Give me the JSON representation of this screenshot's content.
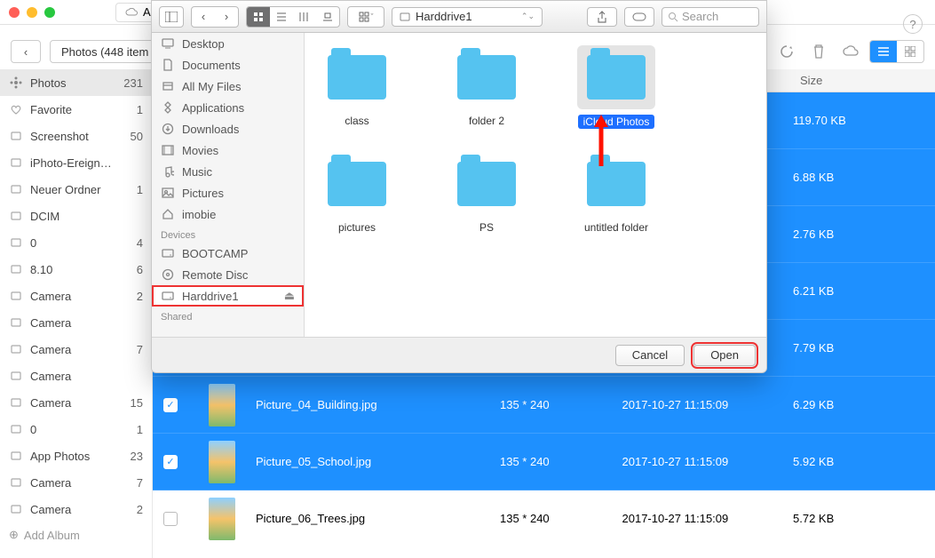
{
  "app": {
    "device_label": "Aaro",
    "help_tooltip": "?",
    "breadcrumb_back": "‹",
    "breadcrumb_label": "Photos (448 item",
    "toolbar": {
      "view_list": "≡",
      "view_grid": "⊞"
    },
    "columns": {
      "size": "Size"
    },
    "sidebar": [
      {
        "icon": "flower",
        "label": "Photos",
        "count": "231",
        "selected": true
      },
      {
        "icon": "heart",
        "label": "Favorite",
        "count": "1"
      },
      {
        "icon": "album",
        "label": "Screenshot",
        "count": "50"
      },
      {
        "icon": "album",
        "label": "iPhoto-Ereign…",
        "count": ""
      },
      {
        "icon": "album",
        "label": "Neuer Ordner",
        "count": "1"
      },
      {
        "icon": "album",
        "label": "DCIM",
        "count": ""
      },
      {
        "icon": "album",
        "label": "0",
        "count": "4"
      },
      {
        "icon": "album",
        "label": "8.10",
        "count": "6"
      },
      {
        "icon": "album",
        "label": "Camera",
        "count": "2"
      },
      {
        "icon": "album",
        "label": "Camera",
        "count": ""
      },
      {
        "icon": "album",
        "label": "Camera",
        "count": "7"
      },
      {
        "icon": "album",
        "label": "Camera",
        "count": ""
      },
      {
        "icon": "album",
        "label": "Camera",
        "count": "15"
      },
      {
        "icon": "album",
        "label": "0",
        "count": "1"
      },
      {
        "icon": "album",
        "label": "App Photos",
        "count": "23"
      },
      {
        "icon": "album",
        "label": "Camera",
        "count": "7"
      },
      {
        "icon": "album",
        "label": "Camera",
        "count": "2"
      }
    ],
    "add_album": "Add Album",
    "files": [
      {
        "checked": false,
        "name": "",
        "dim": "",
        "date": "",
        "size": "119.70 KB",
        "selected": true
      },
      {
        "checked": false,
        "name": "",
        "dim": "",
        "date": "",
        "size": "6.88 KB",
        "selected": true
      },
      {
        "checked": false,
        "name": "",
        "dim": "",
        "date": "",
        "size": "2.76 KB",
        "selected": true
      },
      {
        "checked": false,
        "name": "",
        "dim": "",
        "date": "",
        "size": "6.21 KB",
        "selected": true
      },
      {
        "checked": false,
        "name": "",
        "dim": "",
        "date": "",
        "size": "7.79 KB",
        "selected": true
      },
      {
        "checked": true,
        "name": "Picture_04_Building.jpg",
        "dim": "135 * 240",
        "date": "2017-10-27 11:15:09",
        "size": "6.29 KB",
        "selected": true
      },
      {
        "checked": true,
        "name": "Picture_05_School.jpg",
        "dim": "135 * 240",
        "date": "2017-10-27 11:15:09",
        "size": "5.92 KB",
        "selected": true
      },
      {
        "checked": false,
        "name": "Picture_06_Trees.jpg",
        "dim": "135 * 240",
        "date": "2017-10-27 11:15:09",
        "size": "5.72 KB",
        "selected": false
      }
    ]
  },
  "dialog": {
    "path_current": "Harddrive1",
    "search_placeholder": "Search",
    "sidebar": {
      "favorites": [
        {
          "icon": "desktop",
          "label": "Desktop"
        },
        {
          "icon": "document",
          "label": "Documents"
        },
        {
          "icon": "allfiles",
          "label": "All My Files"
        },
        {
          "icon": "apps",
          "label": "Applications"
        },
        {
          "icon": "download",
          "label": "Downloads"
        },
        {
          "icon": "movies",
          "label": "Movies"
        },
        {
          "icon": "music",
          "label": "Music"
        },
        {
          "icon": "pictures",
          "label": "Pictures"
        },
        {
          "icon": "home",
          "label": "imobie"
        }
      ],
      "devices_header": "Devices",
      "devices": [
        {
          "icon": "disk",
          "label": "BOOTCAMP"
        },
        {
          "icon": "disc",
          "label": "Remote Disc"
        },
        {
          "icon": "disk",
          "label": "Harddrive1",
          "selected": true,
          "ejectable": true
        }
      ],
      "shared_header": "Shared"
    },
    "folders": [
      {
        "name": "class"
      },
      {
        "name": "folder 2"
      },
      {
        "name": "iCloud Photos",
        "selected": true
      },
      {
        "name": "pictures"
      },
      {
        "name": "PS"
      },
      {
        "name": "untitled folder"
      }
    ],
    "buttons": {
      "cancel": "Cancel",
      "open": "Open"
    }
  }
}
